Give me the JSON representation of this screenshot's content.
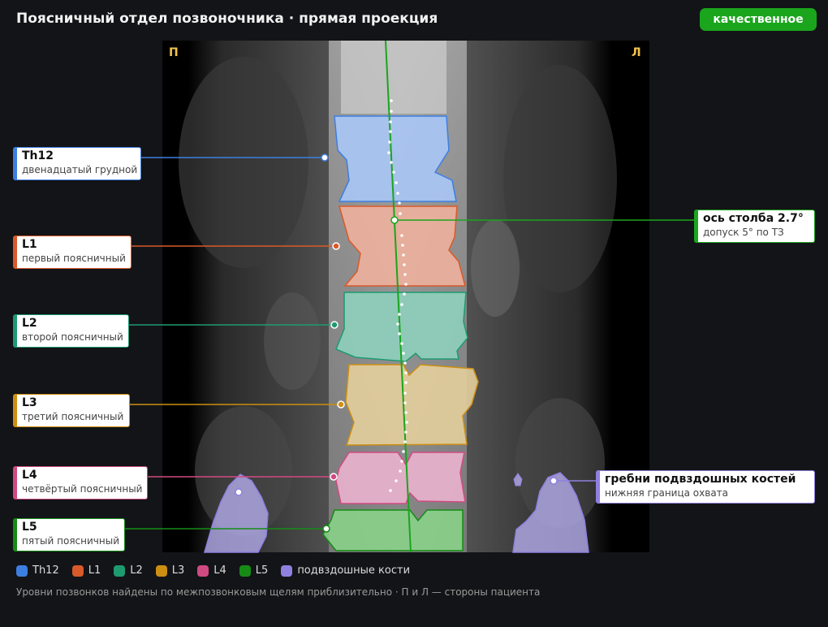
{
  "header": {
    "title": "Поясничный отдел позвоночника · прямая проекция",
    "quality_badge": "качественное",
    "badge_color": "#1aa51d"
  },
  "image": {
    "side_right_patient": "П",
    "side_left_patient": "Л"
  },
  "vertebrae": [
    {
      "id": "th12",
      "name": "Th12",
      "desc": "двенадцатый грудной",
      "color": "#3d7fe0"
    },
    {
      "id": "l1",
      "name": "L1",
      "desc": "первый поясничный",
      "color": "#d85a2a"
    },
    {
      "id": "l2",
      "name": "L2",
      "desc": "второй поясничный",
      "color": "#1e9a70"
    },
    {
      "id": "l3",
      "name": "L3",
      "desc": "третий поясничный",
      "color": "#cc8f12"
    },
    {
      "id": "l4",
      "name": "L4",
      "desc": "четвёртый поясничный",
      "color": "#d04a82"
    },
    {
      "id": "l5",
      "name": "L5",
      "desc": "пятый поясничный",
      "color": "#168c16"
    }
  ],
  "axis": {
    "name": "ось столба 2.7°",
    "desc": "допуск 5° по ТЗ",
    "angle_deg": 2.7,
    "tolerance_deg": 5,
    "color": "#1aa51d"
  },
  "iliac": {
    "name": "гребни подвздошных костей",
    "desc": "нижняя граница охвата",
    "color": "#8f80e0"
  },
  "legend": [
    {
      "label": "Th12",
      "color": "#3d7fe0"
    },
    {
      "label": "L1",
      "color": "#d85a2a"
    },
    {
      "label": "L2",
      "color": "#1e9a70"
    },
    {
      "label": "L3",
      "color": "#cc8f12"
    },
    {
      "label": "L4",
      "color": "#d04a82"
    },
    {
      "label": "L5",
      "color": "#168c16"
    },
    {
      "label": "подвздошные кости",
      "color": "#8f80e0"
    }
  ],
  "footnote": "Уровни позвонков найдены по межпозвонковым щелям приблизительно · П и Л — стороны пациента"
}
